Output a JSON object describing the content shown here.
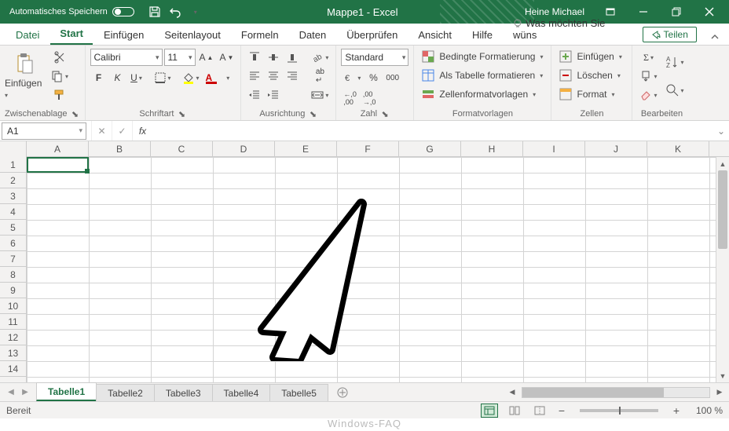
{
  "titlebar": {
    "autosave_label": "Automatisches Speichern",
    "doc_title": "Mappe1  -  Excel",
    "user_name": "Heine Michael"
  },
  "ribbon_tabs": {
    "file": "Datei",
    "home": "Start",
    "insert": "Einfügen",
    "page_layout": "Seitenlayout",
    "formulas": "Formeln",
    "data": "Daten",
    "review": "Überprüfen",
    "view": "Ansicht",
    "help": "Hilfe",
    "tell_me": "Was möchten Sie wüns",
    "share": "Teilen"
  },
  "ribbon": {
    "clipboard": {
      "label": "Zwischenablage",
      "paste": "Einfügen"
    },
    "font": {
      "label": "Schriftart",
      "name": "Calibri",
      "size": "11"
    },
    "alignment": {
      "label": "Ausrichtung"
    },
    "number": {
      "label": "Zahl",
      "format": "Standard"
    },
    "styles": {
      "label": "Formatvorlagen",
      "conditional": "Bedingte Formatierung",
      "table": "Als Tabelle formatieren",
      "cell_styles": "Zellenformatvorlagen"
    },
    "cells": {
      "label": "Zellen",
      "insert": "Einfügen",
      "delete": "Löschen",
      "format": "Format"
    },
    "editing": {
      "label": "Bearbeiten"
    }
  },
  "formula_bar": {
    "cell_ref": "A1",
    "formula": ""
  },
  "columns": [
    "A",
    "B",
    "C",
    "D",
    "E",
    "F",
    "G",
    "H",
    "I",
    "J",
    "K"
  ],
  "rows": [
    "1",
    "2",
    "3",
    "4",
    "5",
    "6",
    "7",
    "8",
    "9",
    "10",
    "11",
    "12",
    "13",
    "14"
  ],
  "sheets": {
    "tabs": [
      "Tabelle1",
      "Tabelle2",
      "Tabelle3",
      "Tabelle4",
      "Tabelle5"
    ],
    "active_index": 0
  },
  "status": {
    "ready": "Bereit",
    "zoom": "100 %"
  },
  "watermark": "Windows-FAQ"
}
